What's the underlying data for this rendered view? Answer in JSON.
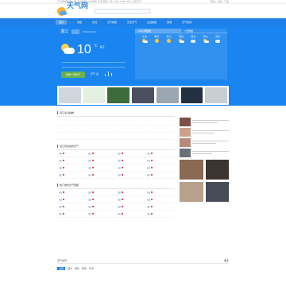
{
  "topbar": {
    "left": "天气预报查询一周,天气预报15天查询,今天,明天,7天,10天,15天,30天,今天天气",
    "right": "登录 | 注册 | 下载"
  },
  "logo": {
    "name": "天气网",
    "tagline": "tianqi.com"
  },
  "nav": [
    "首页",
    "预报",
    "实况",
    "空气质量",
    "历史天气",
    "生活指数",
    "旅游",
    "天气新闻"
  ],
  "current": {
    "city": "湛江",
    "city_en": "ZHANJIANG",
    "temp": "10",
    "unit": "°C",
    "condition": "多云",
    "action": "查看一周天气",
    "aqi_label": "空气 良"
  },
  "forecast": {
    "tabs": [
      "24小时预报",
      "7天预报"
    ],
    "days": [
      {
        "label": "今天",
        "icon": "partly-cloudy"
      },
      {
        "label": "明天",
        "icon": "sunny"
      },
      {
        "label": "周三",
        "icon": "sunny"
      },
      {
        "label": "周四",
        "icon": "partly-cloudy"
      },
      {
        "label": "周五",
        "icon": "cloudy"
      },
      {
        "label": "周六",
        "icon": "partly-cloudy"
      },
      {
        "label": "周日",
        "icon": "cloudy"
      }
    ]
  },
  "sections": [
    {
      "title": "湛江生活指数"
    },
    {
      "title": "湛江周边城市天气"
    },
    {
      "title": "热门城市天气预报"
    }
  ],
  "footer": {
    "title": "天气资讯",
    "more": "更多",
    "tabs": [
      "全部",
      "国内",
      "国际",
      "预警",
      "科普"
    ]
  },
  "colors": {
    "brand": "#1e7fe6",
    "hero": "#1a85f0",
    "green": "#6ab04c"
  }
}
